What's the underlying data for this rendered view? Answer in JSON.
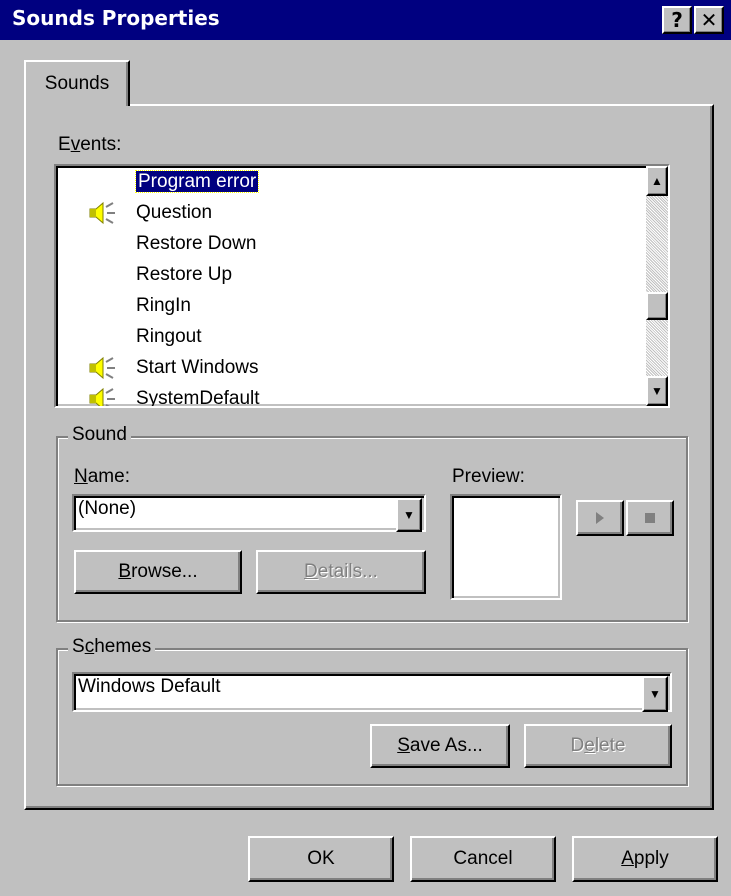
{
  "window": {
    "title": "Sounds Properties",
    "help_label": "?",
    "close_label": "✕"
  },
  "tabs": [
    {
      "label": "Sounds"
    }
  ],
  "events": {
    "label": "Events:",
    "label_mnemonic": "v",
    "items": [
      {
        "label": "Program error",
        "selected": true,
        "has_sound": false
      },
      {
        "label": "Question",
        "selected": false,
        "has_sound": true
      },
      {
        "label": "Restore Down",
        "selected": false,
        "has_sound": false
      },
      {
        "label": "Restore Up",
        "selected": false,
        "has_sound": false
      },
      {
        "label": "RingIn",
        "selected": false,
        "has_sound": false
      },
      {
        "label": "Ringout",
        "selected": false,
        "has_sound": false
      },
      {
        "label": "Start Windows",
        "selected": false,
        "has_sound": true
      },
      {
        "label": "SystemDefault",
        "selected": false,
        "has_sound": true
      }
    ]
  },
  "sound": {
    "group_title": "Sound",
    "name_label": "Name:",
    "name_value": "(None)",
    "preview_label": "Preview:",
    "browse_label": "Browse...",
    "details_label": "Details...",
    "play_icon": "play-icon",
    "stop_icon": "stop-icon"
  },
  "schemes": {
    "group_title": "Schemes",
    "value": "Windows Default",
    "save_as_label": "Save As...",
    "delete_label": "Delete"
  },
  "footer": {
    "ok_label": "OK",
    "cancel_label": "Cancel",
    "apply_label": "Apply"
  },
  "colors": {
    "titlebar": "#000080",
    "face": "#c0c0c0",
    "selection": "#000080"
  }
}
